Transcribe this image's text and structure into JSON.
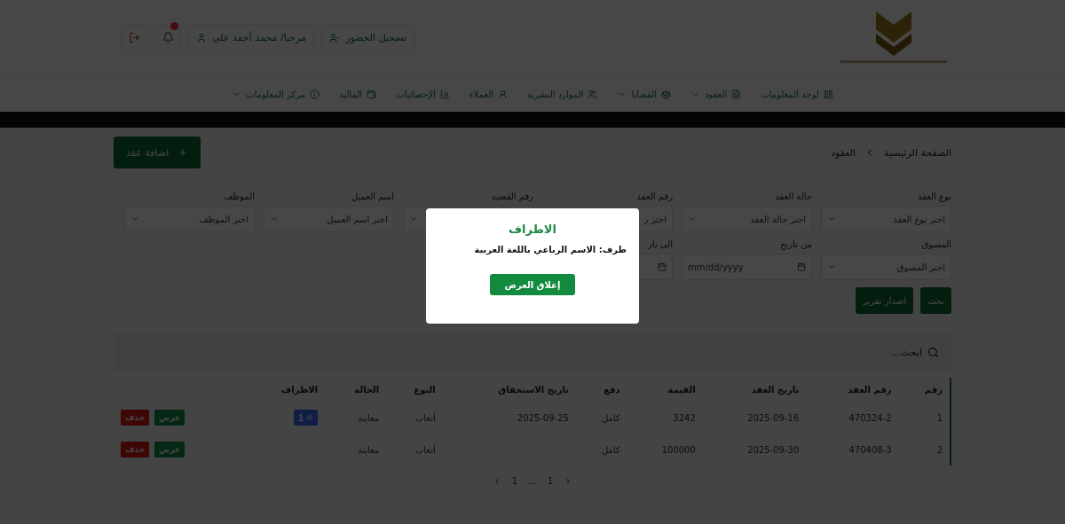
{
  "header": {
    "attendance": "تسجيل الحضور",
    "user": "مرحبا/ محمد أحمد علي"
  },
  "nav": [
    {
      "label": "لوحة المعلومات",
      "dropdown": false
    },
    {
      "label": "العقود",
      "dropdown": true
    },
    {
      "label": "القضايا",
      "dropdown": true
    },
    {
      "label": "الموارد البشرية",
      "dropdown": false
    },
    {
      "label": "العملاء",
      "dropdown": false
    },
    {
      "label": "الإحصائيات",
      "dropdown": false
    },
    {
      "label": "المالية",
      "dropdown": false
    },
    {
      "label": "مركز المعلومات",
      "dropdown": true
    }
  ],
  "breadcrumb": [
    "الصفحة الرئيسية",
    "العقود"
  ],
  "add_button": "اضافة عقد",
  "filters": [
    {
      "kind": "select",
      "label": "نوع العقد",
      "placeholder": "اختر نوع العقد"
    },
    {
      "kind": "select",
      "label": "حالة العقد",
      "placeholder": "اختر حالة العقد"
    },
    {
      "kind": "select",
      "label": "رقم العقد",
      "placeholder": "اختر ر"
    },
    {
      "kind": "select",
      "label": "رقم القضية"
    },
    {
      "kind": "select",
      "label": "اسم العميل",
      "placeholder": "اختر اسم العميل"
    },
    {
      "kind": "select",
      "label": "الموظف",
      "placeholder": "اختر الموظف"
    },
    {
      "kind": "select",
      "label": "المسوق",
      "placeholder": "اختر المسوق"
    },
    {
      "kind": "date",
      "label": "من تاريخ",
      "placeholder": "mm/dd/yyyy"
    },
    {
      "kind": "date",
      "label": "الى تار"
    }
  ],
  "actions": [
    "بحث",
    "اصدار تقرير"
  ],
  "search": {
    "placeholder": "ابحث..."
  },
  "table": {
    "columns": [
      "رقم",
      "رقم العقد",
      "تاريخ العقد",
      "القيمة",
      "دفع",
      "تاريخ الاستحقاق",
      "النوع",
      "الحالة",
      "الاطراف"
    ],
    "rows": [
      {
        "cells": [
          "1",
          "470324-2",
          "2025-09-16",
          "3242",
          "كامل",
          "2025-09-25",
          "أتعاب",
          "معاينة"
        ],
        "parties": "1",
        "view": "عرض",
        "delete": "حذف"
      },
      {
        "cells": [
          "2",
          "470408-3",
          "2025-09-30",
          "100000",
          "كامل",
          "",
          "أتعاب",
          "معاينة"
        ],
        "view": "عرض",
        "delete": "حذف"
      }
    ]
  },
  "pagination": [
    "1",
    "…",
    "1"
  ],
  "modal": {
    "title": "الاطراف",
    "text": "طرف: الاسم الرباعي باللغة العربية",
    "button": "إغلاق العرض"
  }
}
